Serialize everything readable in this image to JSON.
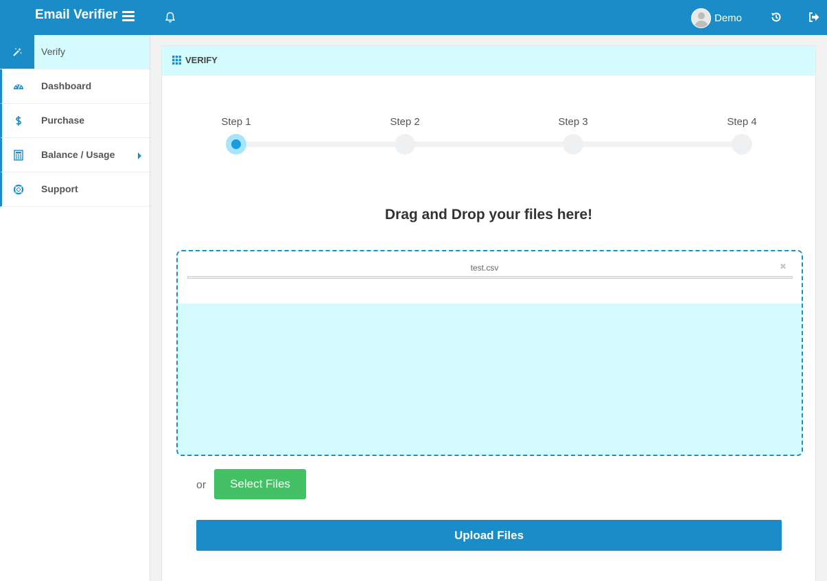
{
  "app": {
    "title": "Email Verifier",
    "accent_color": "#1a8dc8",
    "highlight_color": "#d4fbfd",
    "success_color": "#44c065"
  },
  "header": {
    "menu_icon": "hamburger-menu-icon",
    "notification_icon": "bell-icon",
    "user_name": "Demo",
    "history_icon": "history-icon",
    "logout_icon": "sign-out-icon"
  },
  "sidebar": {
    "items": [
      {
        "label": "Verify",
        "icon": "magic-wand-icon",
        "active": true
      },
      {
        "label": "Dashboard",
        "icon": "dashboard-icon"
      },
      {
        "label": "Purchase",
        "icon": "dollar-icon"
      },
      {
        "label": "Balance / Usage",
        "icon": "calculator-icon",
        "has_submenu": true
      },
      {
        "label": "Support",
        "icon": "life-ring-icon"
      }
    ]
  },
  "panel": {
    "title": "VERIFY",
    "icon": "grid-icon"
  },
  "stepper": {
    "current_step": 1,
    "steps": [
      "Step 1",
      "Step 2",
      "Step 3",
      "Step 4"
    ]
  },
  "dropzone": {
    "heading": "Drag and Drop your files here!",
    "files": [
      {
        "name": "test.csv",
        "remove_icon": "close-icon"
      }
    ]
  },
  "actions": {
    "or_text": "or",
    "select_label": "Select Files",
    "upload_label": "Upload Files"
  }
}
